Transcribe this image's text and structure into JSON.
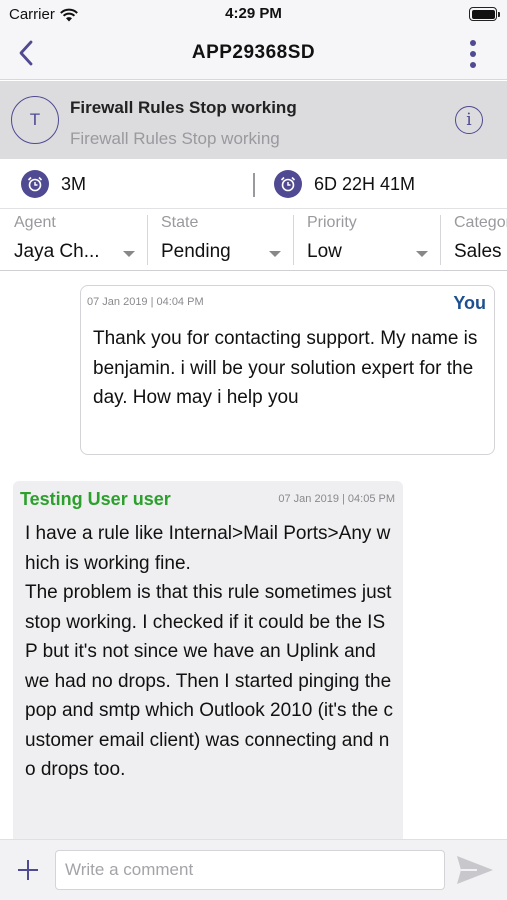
{
  "status_bar": {
    "carrier": "Carrier",
    "time": "4:29 PM"
  },
  "nav": {
    "title": "APP29368SD"
  },
  "ticket": {
    "avatar_letter": "T",
    "title": "Firewall Rules Stop working",
    "subtitle": "Firewall Rules Stop working",
    "info_glyph": "i"
  },
  "timers": [
    {
      "value": "3M",
      "icon": "alarm-clock-icon"
    },
    {
      "value": "6D 22H 41M",
      "icon": "alarm-clock-icon"
    }
  ],
  "fields": [
    {
      "label": "Agent",
      "value": "Jaya Ch..."
    },
    {
      "label": "State",
      "value": "Pending"
    },
    {
      "label": "Priority",
      "value": "Low"
    },
    {
      "label": "Category",
      "value": "Sales"
    }
  ],
  "messages": [
    {
      "author": "You",
      "timestamp": "07 Jan 2019 | 04:04 PM",
      "text": "Thank you for contacting support. My name is benjamin. i will be your solution expert for the day. How may i help you"
    },
    {
      "author": "Testing User user",
      "timestamp": "07 Jan 2019 | 04:05 PM",
      "line1": "I have a rule like Internal>Mail Ports>Any which is working fine.",
      "line2": "The problem is that this rule sometimes just stop working. I checked if it could be the ISP but it's not since we have an Uplink and we had no drops. Then I started pinging the pop and smtp which Outlook 2010 (it's the customer email client) was connecting and no drops too."
    }
  ],
  "composer": {
    "placeholder": "Write a comment"
  },
  "colors": {
    "accent": "#4f4a91",
    "you_label": "#1d4f91",
    "user_label": "#2ca02c"
  }
}
